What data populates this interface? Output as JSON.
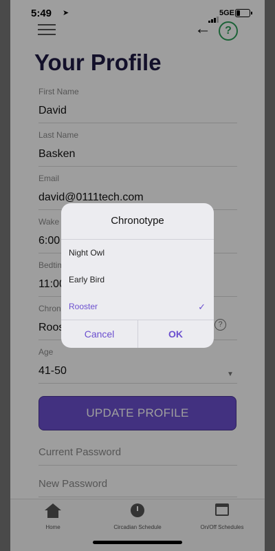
{
  "status_bar": {
    "time": "5:49",
    "network": "5GE"
  },
  "header": {
    "title": "Your Profile"
  },
  "fields": [
    {
      "label": "First Name",
      "value": "David"
    },
    {
      "label": "Last Name",
      "value": "Basken"
    },
    {
      "label": "Email",
      "value": "david@0111tech.com"
    },
    {
      "label": "Wake",
      "value": "6:00"
    },
    {
      "label": "Bedtime",
      "value": "11:00"
    },
    {
      "label": "Chronotype",
      "value": "Rooster"
    },
    {
      "label": "Age",
      "value": "41-50"
    }
  ],
  "update_button": "UPDATE PROFILE",
  "password_fields": {
    "current": "Current Password",
    "new": "New Password"
  },
  "tabs": [
    {
      "label": "Home",
      "icon": "home-icon"
    },
    {
      "label": "Circadian Schedule",
      "icon": "clock-icon"
    },
    {
      "label": "On/Off Schedules",
      "icon": "calendar-icon"
    }
  ],
  "dialog": {
    "title": "Chronotype",
    "options": [
      "Night Owl",
      "Early Bird",
      "Rooster"
    ],
    "selected": "Rooster",
    "cancel": "Cancel",
    "ok": "OK"
  },
  "colors": {
    "accent": "#6b4fcf",
    "help": "#2e9e5a",
    "title": "#1f1a44"
  }
}
